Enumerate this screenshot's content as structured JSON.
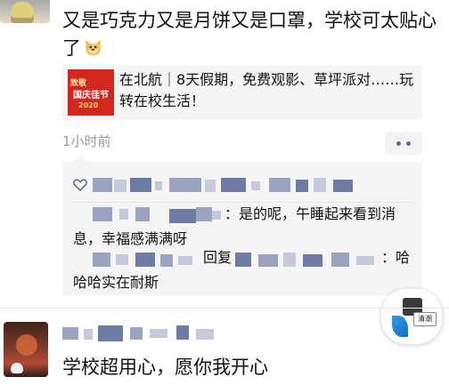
{
  "post1": {
    "text": "又是巧克力又是月饼又是口罩，学校可太贴心了",
    "emoji_icon": "doge-emoji-icon",
    "article": {
      "thumb_text_top": "致敬",
      "thumb_text_mid": "国庆佳节",
      "thumb_text_year": "2020",
      "title": "在北航｜8天假期，免费观影、草坪派对……玩转在校生活！"
    },
    "time": "1小时前",
    "comments": [
      {
        "visible_text": "：是的呢，午睡起来看到消息，幸福感满满呀"
      },
      {
        "reply_word": "回复",
        "visible_text": "：哈哈哈实在耐斯"
      }
    ]
  },
  "float_widget": {
    "tag": "清潮"
  },
  "post2": {
    "text": "学校超用心，愿你我开心"
  },
  "colors": {
    "card_bg": "#f5f5f5",
    "link_blue": "#5b6b92",
    "time_gray": "#9a9a9a",
    "thumb_red": "#d3261e"
  }
}
